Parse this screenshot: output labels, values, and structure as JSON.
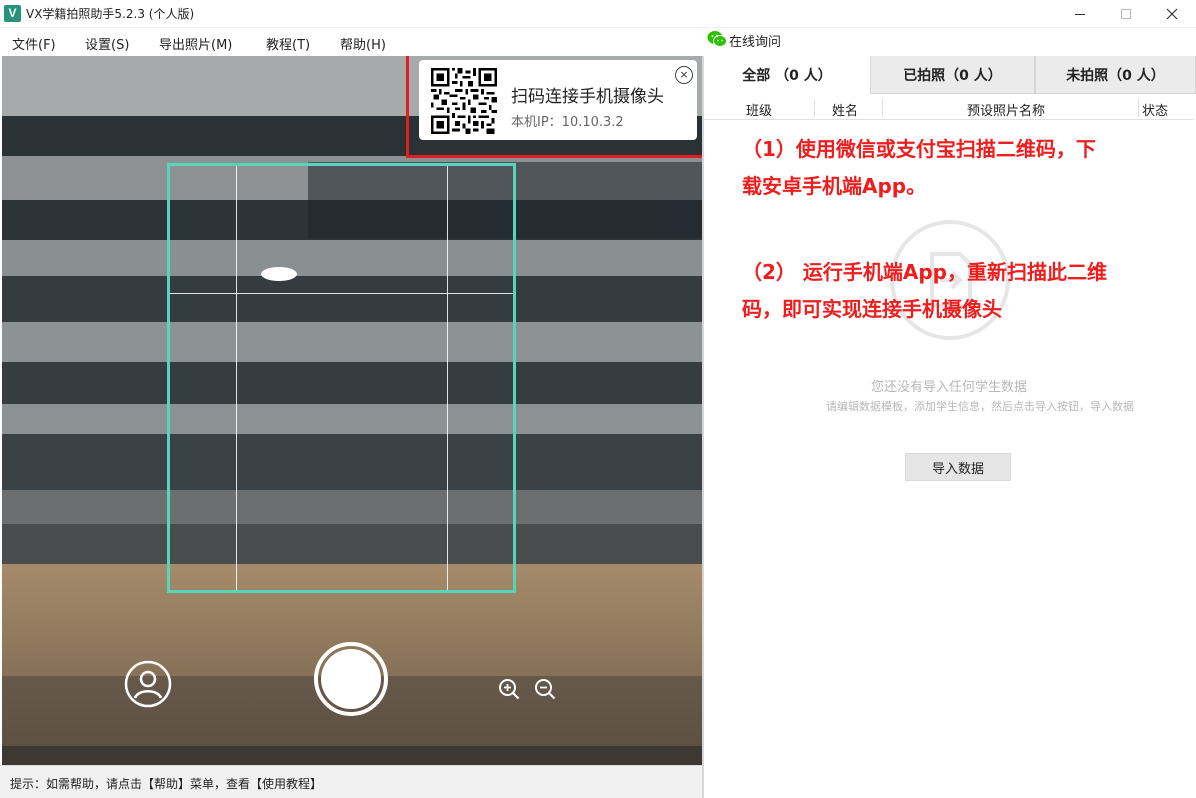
{
  "window": {
    "logo_letter": "V",
    "title": "VX学籍拍照助手5.2.3 (个人版)"
  },
  "menu": {
    "items": [
      "文件(F)",
      "设置(S)",
      "导出照片(M)",
      "教程(T)",
      "帮助(H)"
    ]
  },
  "online": {
    "label": "在线询问"
  },
  "qr_popup": {
    "title": "扫码连接手机摄像头",
    "ip": "本机IP：10.10.3.2",
    "close_glyph": "×"
  },
  "tabs": [
    "全部 （0 人）",
    "已拍照（0 人）",
    "未拍照（0 人）"
  ],
  "table": {
    "columns": [
      "班级",
      "姓名",
      "预设照片名称",
      "状态"
    ]
  },
  "instructions": {
    "step1": "（1）使用微信或支付宝扫描二维码，下载安卓手机端App。",
    "step2": "（2） 运行手机端App，重新扫描此二维码，即可实现连接手机摄像头"
  },
  "empty_state": {
    "main": "您还没有导入任何学生数据",
    "sub": "请编辑数据模板，添加学生信息，然后点击导入按钮，导入数据",
    "import_button": "导入数据"
  },
  "status_bar": {
    "text": "提示：如需帮助，请点击【帮助】菜单，查看【使用教程】"
  },
  "colors": {
    "accent_frame": "#55d6b8",
    "annotation_red": "#ef1e1e",
    "logo_green": "#27937a"
  }
}
